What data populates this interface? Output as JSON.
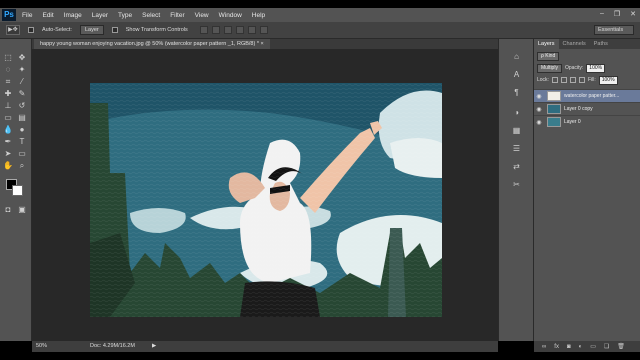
{
  "app": {
    "logo": "Ps"
  },
  "menu": [
    "File",
    "Edit",
    "Image",
    "Layer",
    "Type",
    "Select",
    "Filter",
    "View",
    "Window",
    "Help"
  ],
  "window_controls": {
    "minimize": "–",
    "restore": "❐",
    "close": "✕"
  },
  "options_bar": {
    "tool_glyph": "▶✥",
    "auto_select_label": "Auto-Select:",
    "auto_select_target": "Layer",
    "transform_label": "Show Transform Controls",
    "workspace": "Essentials"
  },
  "document_tab": {
    "title": "happy young woman enjoying vacation.jpg @ 50% (watercolor paper pattern _1, RGB/8) * ×"
  },
  "status": {
    "zoom": "50%",
    "doc": "Doc: 4.29M/16.2M"
  },
  "layers_panel": {
    "tabs": [
      "Layers",
      "Channels",
      "Paths"
    ],
    "kind_filter": "ρ Kind",
    "blend_mode": "Multiply",
    "opacity_label": "Opacity:",
    "opacity_value": "100%",
    "lock_label": "Lock:",
    "fill_label": "Fill:",
    "fill_value": "100%",
    "layers": [
      {
        "name": "watercolor paper patter...",
        "selected": true
      },
      {
        "name": "Layer 0 copy",
        "selected": false
      },
      {
        "name": "Layer 0",
        "selected": false
      }
    ]
  },
  "colors": {
    "chrome": "#535353",
    "canvas_bg": "#282828",
    "sky": "#2f6d80",
    "selection": "#6a7a9a"
  }
}
